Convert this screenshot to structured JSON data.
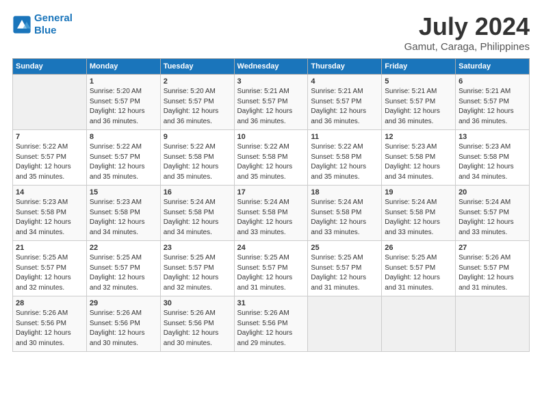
{
  "header": {
    "logo_line1": "General",
    "logo_line2": "Blue",
    "title": "July 2024",
    "subtitle": "Gamut, Caraga, Philippines"
  },
  "columns": [
    "Sunday",
    "Monday",
    "Tuesday",
    "Wednesday",
    "Thursday",
    "Friday",
    "Saturday"
  ],
  "weeks": [
    {
      "cells": [
        {
          "day": "",
          "info": ""
        },
        {
          "day": "1",
          "info": "Sunrise: 5:20 AM\nSunset: 5:57 PM\nDaylight: 12 hours\nand 36 minutes."
        },
        {
          "day": "2",
          "info": "Sunrise: 5:20 AM\nSunset: 5:57 PM\nDaylight: 12 hours\nand 36 minutes."
        },
        {
          "day": "3",
          "info": "Sunrise: 5:21 AM\nSunset: 5:57 PM\nDaylight: 12 hours\nand 36 minutes."
        },
        {
          "day": "4",
          "info": "Sunrise: 5:21 AM\nSunset: 5:57 PM\nDaylight: 12 hours\nand 36 minutes."
        },
        {
          "day": "5",
          "info": "Sunrise: 5:21 AM\nSunset: 5:57 PM\nDaylight: 12 hours\nand 36 minutes."
        },
        {
          "day": "6",
          "info": "Sunrise: 5:21 AM\nSunset: 5:57 PM\nDaylight: 12 hours\nand 36 minutes."
        }
      ]
    },
    {
      "cells": [
        {
          "day": "7",
          "info": "Sunrise: 5:22 AM\nSunset: 5:57 PM\nDaylight: 12 hours\nand 35 minutes."
        },
        {
          "day": "8",
          "info": "Sunrise: 5:22 AM\nSunset: 5:57 PM\nDaylight: 12 hours\nand 35 minutes."
        },
        {
          "day": "9",
          "info": "Sunrise: 5:22 AM\nSunset: 5:58 PM\nDaylight: 12 hours\nand 35 minutes."
        },
        {
          "day": "10",
          "info": "Sunrise: 5:22 AM\nSunset: 5:58 PM\nDaylight: 12 hours\nand 35 minutes."
        },
        {
          "day": "11",
          "info": "Sunrise: 5:22 AM\nSunset: 5:58 PM\nDaylight: 12 hours\nand 35 minutes."
        },
        {
          "day": "12",
          "info": "Sunrise: 5:23 AM\nSunset: 5:58 PM\nDaylight: 12 hours\nand 34 minutes."
        },
        {
          "day": "13",
          "info": "Sunrise: 5:23 AM\nSunset: 5:58 PM\nDaylight: 12 hours\nand 34 minutes."
        }
      ]
    },
    {
      "cells": [
        {
          "day": "14",
          "info": "Sunrise: 5:23 AM\nSunset: 5:58 PM\nDaylight: 12 hours\nand 34 minutes."
        },
        {
          "day": "15",
          "info": "Sunrise: 5:23 AM\nSunset: 5:58 PM\nDaylight: 12 hours\nand 34 minutes."
        },
        {
          "day": "16",
          "info": "Sunrise: 5:24 AM\nSunset: 5:58 PM\nDaylight: 12 hours\nand 34 minutes."
        },
        {
          "day": "17",
          "info": "Sunrise: 5:24 AM\nSunset: 5:58 PM\nDaylight: 12 hours\nand 33 minutes."
        },
        {
          "day": "18",
          "info": "Sunrise: 5:24 AM\nSunset: 5:58 PM\nDaylight: 12 hours\nand 33 minutes."
        },
        {
          "day": "19",
          "info": "Sunrise: 5:24 AM\nSunset: 5:58 PM\nDaylight: 12 hours\nand 33 minutes."
        },
        {
          "day": "20",
          "info": "Sunrise: 5:24 AM\nSunset: 5:57 PM\nDaylight: 12 hours\nand 33 minutes."
        }
      ]
    },
    {
      "cells": [
        {
          "day": "21",
          "info": "Sunrise: 5:25 AM\nSunset: 5:57 PM\nDaylight: 12 hours\nand 32 minutes."
        },
        {
          "day": "22",
          "info": "Sunrise: 5:25 AM\nSunset: 5:57 PM\nDaylight: 12 hours\nand 32 minutes."
        },
        {
          "day": "23",
          "info": "Sunrise: 5:25 AM\nSunset: 5:57 PM\nDaylight: 12 hours\nand 32 minutes."
        },
        {
          "day": "24",
          "info": "Sunrise: 5:25 AM\nSunset: 5:57 PM\nDaylight: 12 hours\nand 31 minutes."
        },
        {
          "day": "25",
          "info": "Sunrise: 5:25 AM\nSunset: 5:57 PM\nDaylight: 12 hours\nand 31 minutes."
        },
        {
          "day": "26",
          "info": "Sunrise: 5:25 AM\nSunset: 5:57 PM\nDaylight: 12 hours\nand 31 minutes."
        },
        {
          "day": "27",
          "info": "Sunrise: 5:26 AM\nSunset: 5:57 PM\nDaylight: 12 hours\nand 31 minutes."
        }
      ]
    },
    {
      "cells": [
        {
          "day": "28",
          "info": "Sunrise: 5:26 AM\nSunset: 5:56 PM\nDaylight: 12 hours\nand 30 minutes."
        },
        {
          "day": "29",
          "info": "Sunrise: 5:26 AM\nSunset: 5:56 PM\nDaylight: 12 hours\nand 30 minutes."
        },
        {
          "day": "30",
          "info": "Sunrise: 5:26 AM\nSunset: 5:56 PM\nDaylight: 12 hours\nand 30 minutes."
        },
        {
          "day": "31",
          "info": "Sunrise: 5:26 AM\nSunset: 5:56 PM\nDaylight: 12 hours\nand 29 minutes."
        },
        {
          "day": "",
          "info": ""
        },
        {
          "day": "",
          "info": ""
        },
        {
          "day": "",
          "info": ""
        }
      ]
    }
  ]
}
